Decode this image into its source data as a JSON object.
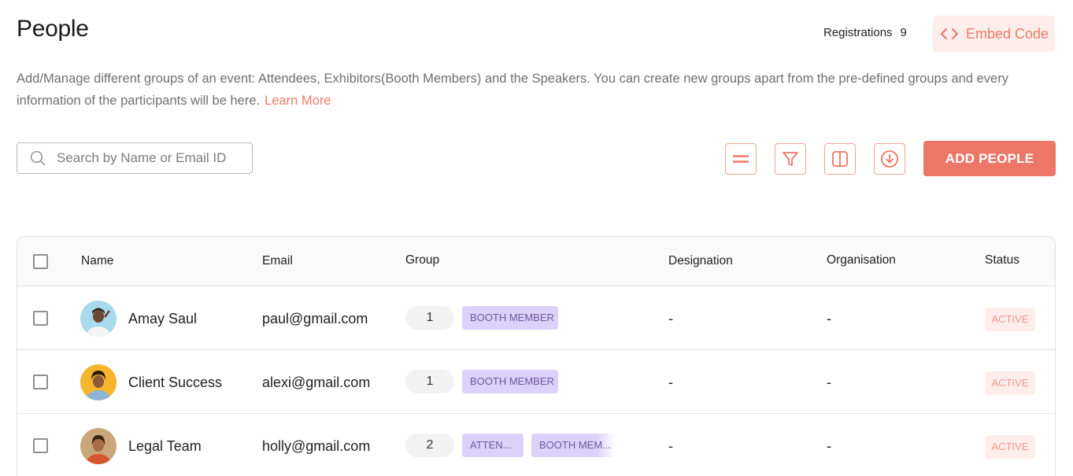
{
  "header": {
    "title": "People",
    "registrations_label": "Registrations",
    "registrations_count": "9",
    "embed_label": "Embed Code"
  },
  "description": {
    "text": "Add/Manage different groups of an event: Attendees, Exhibitors(Booth Members) and the Speakers. You can create new groups apart from the pre-defined groups and every information of the participants will be here.",
    "link_label": "Learn More"
  },
  "toolbar": {
    "search_placeholder": "Search by Name or Email ID",
    "search_value": "",
    "icons": [
      "rows-icon",
      "filter-icon",
      "columns-icon",
      "download-icon"
    ],
    "add_label": "ADD PEOPLE"
  },
  "table": {
    "columns": [
      "Name",
      "Email",
      "Group",
      "Designation",
      "Organisation",
      "Status"
    ],
    "rows": [
      {
        "name": "Amay Saul",
        "email": "paul@gmail.com",
        "group_count": "1",
        "tags": [
          "BOOTH MEMBER"
        ],
        "designation": "-",
        "organisation": "-",
        "status": "ACTIVE"
      },
      {
        "name": "Client Success",
        "email": "alexi@gmail.com",
        "group_count": "1",
        "tags": [
          "BOOTH MEMBER"
        ],
        "designation": "-",
        "organisation": "-",
        "status": "ACTIVE"
      },
      {
        "name": "Legal Team",
        "email": "holly@gmail.com",
        "group_count": "2",
        "tags": [
          "ATTEN...",
          "BOOTH MEM..."
        ],
        "designation": "-",
        "organisation": "-",
        "status": "ACTIVE"
      }
    ]
  },
  "colors": {
    "accent": "#ec7766",
    "accent_light": "#fdeeec",
    "tag_bg": "#dcd1fb",
    "tag_text": "#6b5a9a"
  }
}
